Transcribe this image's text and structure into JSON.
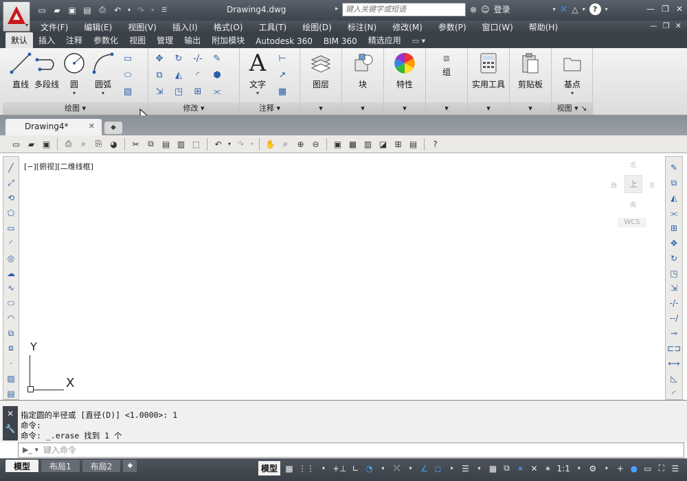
{
  "titlebar": {
    "document_title": "Drawing4.dwg",
    "search_placeholder": "键入关键字或短语",
    "login_label": "登录"
  },
  "menu": {
    "items": [
      "文件(F)",
      "编辑(E)",
      "视图(V)",
      "插入(I)",
      "格式(O)",
      "工具(T)",
      "绘图(D)",
      "标注(N)",
      "修改(M)",
      "参数(P)",
      "窗口(W)",
      "帮助(H)"
    ]
  },
  "ribbon_tabs": [
    "默认",
    "插入",
    "注释",
    "参数化",
    "视图",
    "管理",
    "输出",
    "附加模块",
    "Autodesk 360",
    "BIM 360",
    "精选应用"
  ],
  "ribbon": {
    "draw": {
      "title": "绘图",
      "line": "直线",
      "polyline": "多段线",
      "circle": "圆",
      "arc": "圆弧"
    },
    "modify": {
      "title": "修改"
    },
    "annotation": {
      "title": "注释",
      "text": "文字"
    },
    "layers": "图层",
    "block": "块",
    "properties": "特性",
    "group": "组",
    "utilities": "实用工具",
    "clipboard": "剪贴板",
    "view": {
      "title": "视图",
      "base": "基点"
    }
  },
  "doc_tab": {
    "name": "Drawing4*"
  },
  "viewport": {
    "label": "[−][俯视][二维线框]",
    "viewcube": {
      "north": "北",
      "south": "南",
      "east": "东",
      "west": "西",
      "top": "上",
      "wcs": "WCS"
    },
    "ucs": {
      "x": "X",
      "y": "Y"
    }
  },
  "command": {
    "history": [
      "指定圆的半径或 [直径(D)] <1.0000>: 1",
      "命令:",
      "命令: _.erase 找到 1 个"
    ],
    "placeholder": "键入命令"
  },
  "status": {
    "layout_tabs": [
      "模型",
      "布局1",
      "布局2"
    ],
    "model_label": "模型",
    "scale": "1:1"
  }
}
